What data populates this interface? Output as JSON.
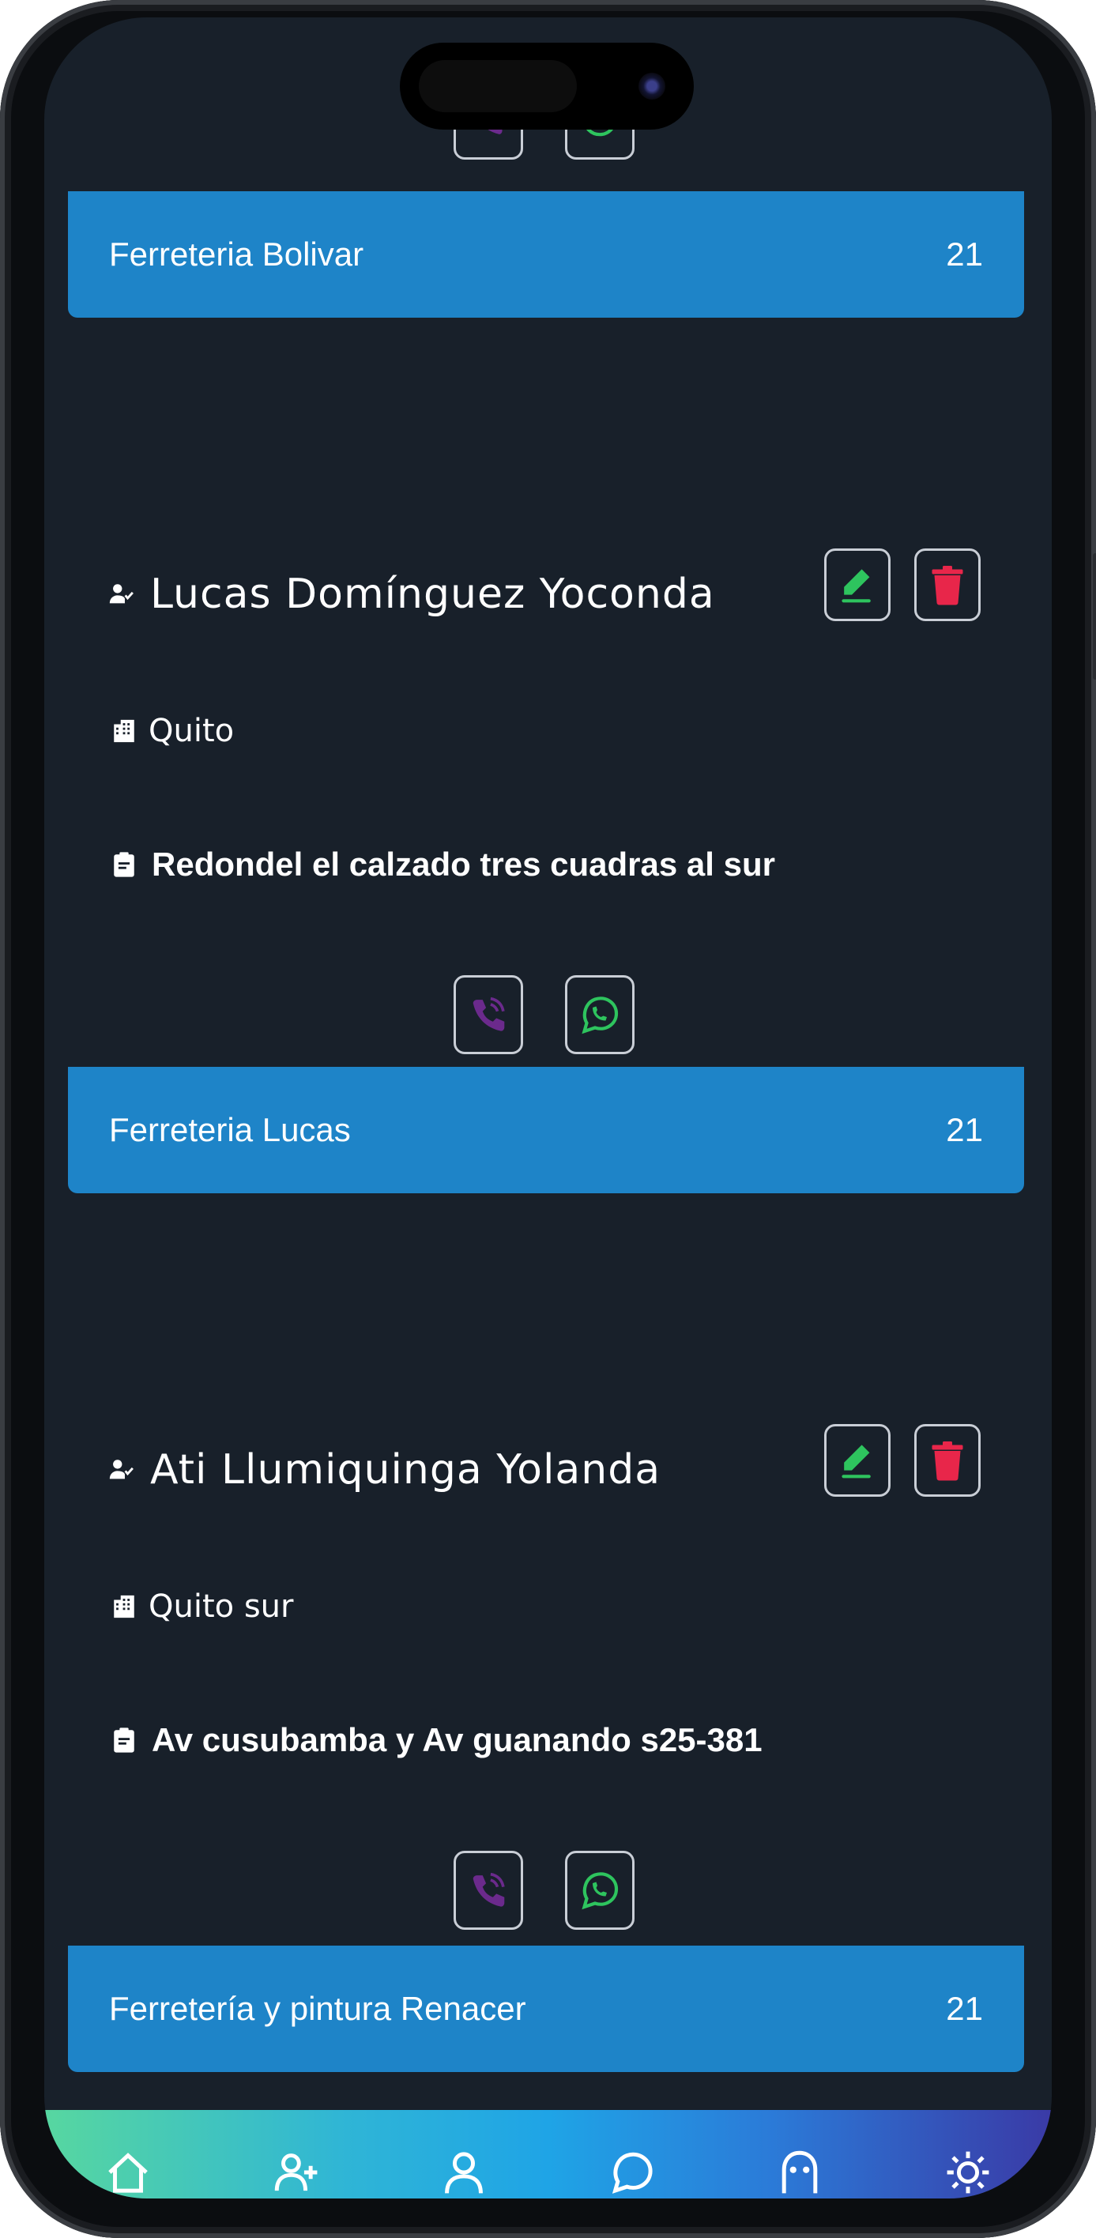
{
  "colors": {
    "background": "#18202a",
    "banner": "#1e84c8",
    "edit_green": "#2ec45e",
    "delete_red": "#e8264a",
    "call_purple": "#6b2a8c",
    "whatsapp_green": "#2ec45e"
  },
  "list": {
    "banners": [
      {
        "name": "Ferreteria Bolivar",
        "count": "21"
      },
      {
        "name": "Ferreteria Lucas",
        "count": "21"
      },
      {
        "name": "Ferretería y pintura Renacer",
        "count": "21"
      }
    ],
    "contacts": [
      {
        "name": "Lucas Domínguez Yoconda",
        "city": "Quito",
        "address": "Redondel el calzado tres cuadras al sur"
      },
      {
        "name": "Ati Llumiquinga Yolanda",
        "city": "Quito sur",
        "address": "Av cusubamba y Av guanando s25-381"
      }
    ]
  },
  "icons": {
    "person": "person-check-icon",
    "city": "building-icon",
    "address": "clipboard-icon",
    "edit": "pencil-icon",
    "delete": "trash-icon",
    "call": "phone-call-icon",
    "whatsapp": "whatsapp-icon"
  },
  "navbar": {
    "items": [
      "home-icon",
      "add-user-icon",
      "user-icon",
      "whatsapp-icon",
      "ghost-icon",
      "settings-icon"
    ]
  }
}
